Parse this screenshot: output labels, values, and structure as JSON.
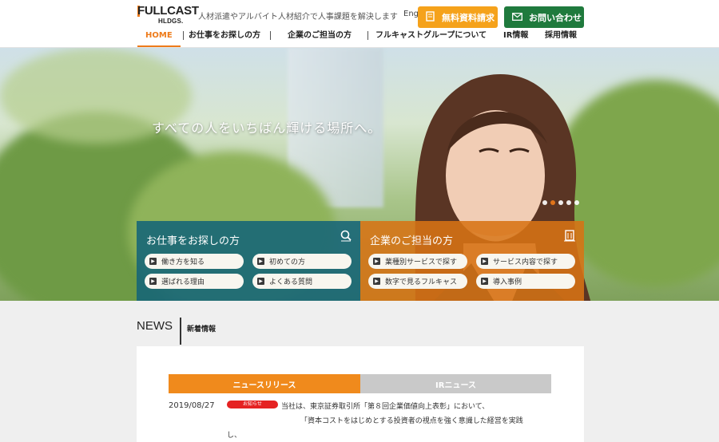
{
  "header": {
    "logo_main": "FULLCAST",
    "logo_sub": "HLDGS.",
    "tagline": "人材派遣やアルバイト人材紹介で人事課題を解決します",
    "lang": "Eng",
    "doc_button": "無料資料請求",
    "contact_button": "お問い合わせ"
  },
  "nav": {
    "items": [
      "HOME",
      "お仕事をお探しの方",
      "企業のご担当の方",
      "フルキャストグループについて",
      "IR情報",
      "採用情報"
    ]
  },
  "hero": {
    "catch": "すべての人をいちばん輝ける場所へ。",
    "slide_count": 5,
    "active_slide": 2
  },
  "panels": {
    "seek": {
      "title": "お仕事をお探しの方",
      "links": [
        "働き方を知る",
        "初めての方",
        "選ばれる理由",
        "よくある質問"
      ]
    },
    "corp": {
      "title": "企業のご担当の方",
      "links": [
        "業種別サービスで探す",
        "サービス内容で探す",
        "数字で見るフルキャス",
        "導入事例"
      ]
    }
  },
  "news": {
    "heading": "NEWS",
    "sub": "新着情報",
    "tabs": [
      "ニュースリリース",
      "IRニュース"
    ],
    "items": [
      {
        "date": "2019/08/27",
        "badge": "お知らせ",
        "line1": "当社は、東京証券取引所「第８回企業価値向上表彰」において、",
        "line2": "「資本コストをはじめとする投資者の視点を強く意識した経営を実践",
        "line3": "し、"
      }
    ]
  },
  "colors": {
    "accent": "#ee7b1a",
    "doc_button": "#f5a21b",
    "contact_button": "#1f7a3d",
    "seek_panel": "#146478",
    "corp_panel": "#d77314"
  }
}
